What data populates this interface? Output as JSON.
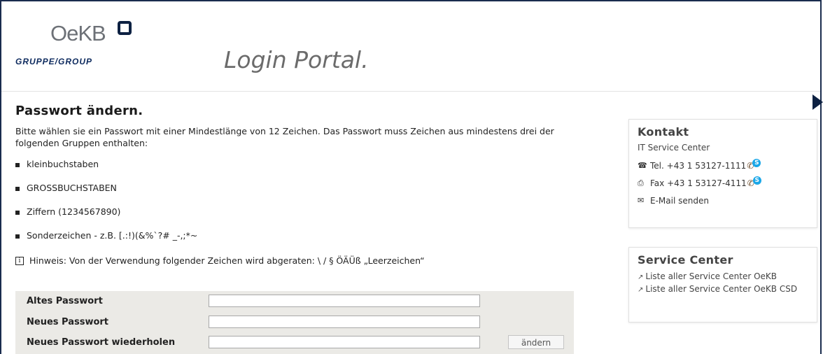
{
  "header": {
    "logo_text": "OeKB",
    "logo_group": "GRUPPE/GROUP",
    "portal_title": "Login Portal."
  },
  "main": {
    "heading": "Passwort ändern.",
    "intro": "Bitte wählen sie ein Passwort mit einer Mindestlänge von 12 Zeichen. Das Passwort muss Zeichen aus mindestens drei der folgenden Gruppen enthalten:",
    "rules": [
      "kleinbuchstaben",
      "GROSSBUCHSTABEN",
      "Ziffern (1234567890)",
      "Sonderzeichen - z.B. [.:!)(&%`?# _-,;*~"
    ],
    "hint": "Hinweis: Von der Verwendung folgender Zeichen wird abgeraten: \\ / § ÖÄÜß „Leerzeichen“"
  },
  "form": {
    "old_label": "Altes Passwort",
    "new_label": "Neues Passwort",
    "repeat_label": "Neues Passwort wiederholen",
    "old_value": "",
    "new_value": "",
    "repeat_value": "",
    "submit_label": "ändern"
  },
  "contact": {
    "title": "Kontakt",
    "subtitle": "IT Service Center",
    "tel": "Tel. +43 1 53127-1111",
    "fax": "Fax +43 1 53127-4111",
    "email": "E-Mail senden"
  },
  "service_center": {
    "title": "Service Center",
    "links": [
      "Liste aller Service Center OeKB",
      "Liste aller Service Center OeKB CSD"
    ]
  },
  "colors": {
    "brand_navy": "#0d2142",
    "form_bg": "#ebeae6",
    "skype_blue": "#1aa7e8"
  },
  "icons": {
    "tel": "phone-icon",
    "fax": "fax-icon",
    "email": "mail-icon",
    "external": "external-link-icon",
    "info": "info-icon"
  }
}
